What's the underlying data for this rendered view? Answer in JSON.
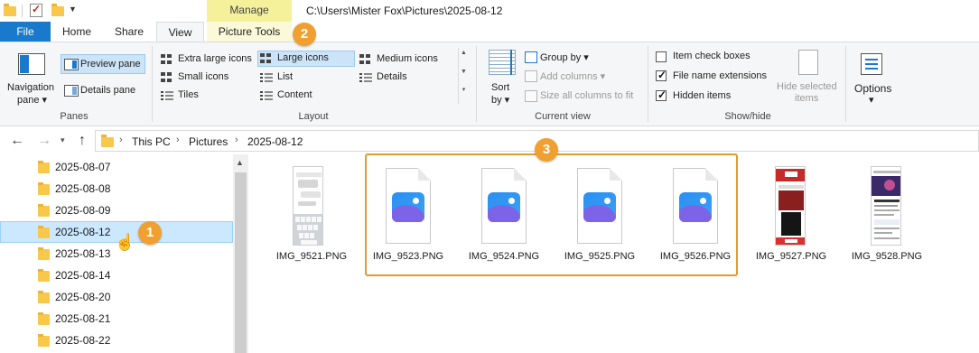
{
  "title_bar": {
    "manage_tab": "Manage",
    "path": "C:\\Users\\Mister Fox\\Pictures\\2025-08-12"
  },
  "tabs": [
    {
      "label": "File"
    },
    {
      "label": "Home"
    },
    {
      "label": "Share"
    },
    {
      "label": "View"
    },
    {
      "label": "Picture Tools"
    }
  ],
  "ribbon": {
    "panes": {
      "group_label": "Panes",
      "navigation_pane_l1": "Navigation",
      "navigation_pane_l2": "pane",
      "preview_pane": "Preview pane",
      "details_pane": "Details pane"
    },
    "layout": {
      "group_label": "Layout",
      "extra_large_icons": "Extra large icons",
      "large_icons": "Large icons",
      "medium_icons": "Medium icons",
      "small_icons": "Small icons",
      "list": "List",
      "details": "Details",
      "tiles": "Tiles",
      "content": "Content"
    },
    "current_view": {
      "group_label": "Current view",
      "sort_by_l1": "Sort",
      "sort_by_l2": "by",
      "group_by": "Group by",
      "add_columns": "Add columns",
      "size_all_columns": "Size all columns to fit"
    },
    "show_hide": {
      "group_label": "Show/hide",
      "item_check_boxes": "Item check boxes",
      "item_check_boxes_checked": false,
      "file_name_extensions": "File name extensions",
      "file_name_extensions_checked": true,
      "hidden_items": "Hidden items",
      "hidden_items_checked": true,
      "hide_selected_l1": "Hide selected",
      "hide_selected_l2": "items"
    },
    "options": {
      "label": "Options"
    }
  },
  "address_bar": {
    "crumbs": [
      "This PC",
      "Pictures",
      "2025-08-12"
    ]
  },
  "nav_tree": {
    "items": [
      "2025-08-07",
      "2025-08-08",
      "2025-08-09",
      "2025-08-12",
      "2025-08-13",
      "2025-08-14",
      "2025-08-20",
      "2025-08-21",
      "2025-08-22"
    ],
    "selected": "2025-08-12"
  },
  "files": [
    {
      "name": "IMG_9521.PNG",
      "kind": "thumbnail-chat"
    },
    {
      "name": "IMG_9523.PNG",
      "kind": "generic-photo-icon"
    },
    {
      "name": "IMG_9524.PNG",
      "kind": "generic-photo-icon"
    },
    {
      "name": "IMG_9525.PNG",
      "kind": "generic-photo-icon"
    },
    {
      "name": "IMG_9526.PNG",
      "kind": "generic-photo-icon"
    },
    {
      "name": "IMG_9527.PNG",
      "kind": "thumbnail-red"
    },
    {
      "name": "IMG_9528.PNG",
      "kind": "thumbnail-dark"
    }
  ],
  "annotations": {
    "badge_1": "1",
    "badge_2": "2",
    "badge_3": "3",
    "color": "#f0a030"
  },
  "colors": {
    "accent": "#1979ca",
    "selection": "#cce8ff",
    "manage_tab": "#f4f19a"
  }
}
